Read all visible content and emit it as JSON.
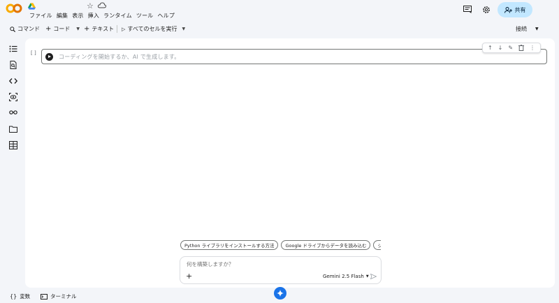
{
  "header": {
    "menu": [
      "ファイル",
      "編集",
      "表示",
      "挿入",
      "ランタイム",
      "ツール",
      "ヘルプ"
    ],
    "share_label": "共有"
  },
  "toolbar": {
    "command_label": "コマンド",
    "code_label": "コード",
    "text_label": "テキスト",
    "run_all_label": "すべてのセルを実行",
    "connect_label": "接続"
  },
  "cell": {
    "bracket": "[ ]",
    "placeholder": "コーディングを開始するか、AI で生成します。"
  },
  "suggestions": [
    "Python ライブラリをインストールする方法",
    "Google ドライブからデータを読み込む",
    "シンプルな M"
  ],
  "prompt": {
    "placeholder": "何を構築しますか？",
    "model": "Gemini 2.5 Flash"
  },
  "bottom": {
    "variables_label": "変数",
    "terminal_label": "ターミナル"
  },
  "colors": {
    "accent": "#1a73e8",
    "share_bg": "#c2e7ff",
    "logo_orange": "#f9ab00",
    "logo_amber": "#e37400"
  }
}
